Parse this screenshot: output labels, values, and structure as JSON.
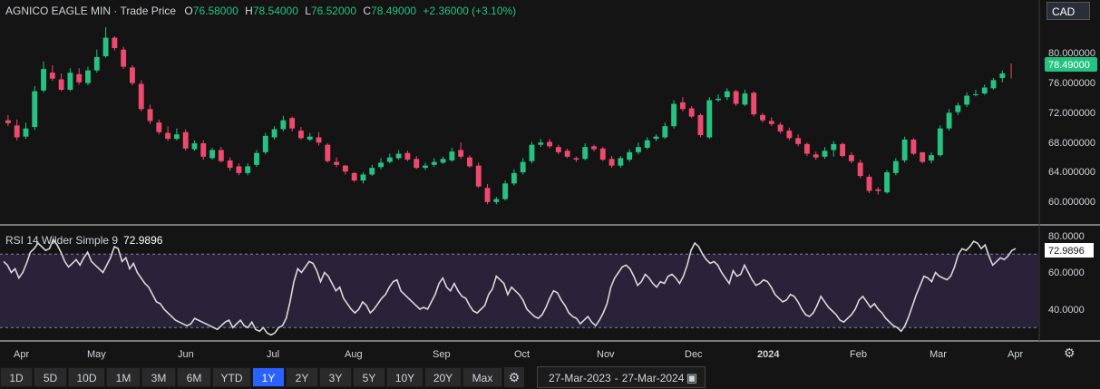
{
  "header": {
    "symbol": "AGNICO EAGLE MIN",
    "field": "Trade Price",
    "o_label": "O",
    "o": "76.58000",
    "h_label": "H",
    "h": "78.54000",
    "l_label": "L",
    "l": "76.52000",
    "c_label": "C",
    "c": "78.49000",
    "change": "+2.36000 (+3.10%)"
  },
  "currency": "CAD",
  "rsi_header": {
    "label": "RSI 14 Wilder Simple 9",
    "value": "72.9896"
  },
  "price_axis": {
    "ticks": [
      "80.000000",
      "76.000000",
      "72.000000",
      "68.000000",
      "64.000000",
      "60.000000"
    ],
    "last_price": "78.49000",
    "last_price_color": "#26c281"
  },
  "rsi_axis": {
    "ticks": [
      "80.0000",
      "60.0000",
      "40.0000"
    ],
    "last_value": "72.9896"
  },
  "x_axis": [
    "Apr",
    "May",
    "Jun",
    "Jul",
    "Aug",
    "Sep",
    "Oct",
    "Nov",
    "Dec",
    "2024",
    "Feb",
    "Mar",
    "Apr"
  ],
  "range_buttons": [
    "1D",
    "5D",
    "10D",
    "1M",
    "3M",
    "6M",
    "YTD",
    "1Y",
    "2Y",
    "3Y",
    "5Y",
    "10Y",
    "20Y",
    "Max"
  ],
  "range_active": "1Y",
  "date_range": {
    "from": "27-Mar-2023",
    "sep": "-",
    "to": "27-Mar-2024"
  },
  "icons": {
    "settings": "gear-icon",
    "calendar": "calendar-icon",
    "axis_settings": "gear-icon"
  },
  "colors": {
    "up": "#26c281",
    "down": "#ef4a6d",
    "rsi_line": "#d9d9d9",
    "rsi_band": "#2a2238"
  },
  "chart_data": [
    {
      "type": "candlestick",
      "title": "AGNICO EAGLE MIN - Trade Price",
      "ylim": [
        58,
        84
      ],
      "x": [
        "Apr",
        "May",
        "Jun",
        "Jul",
        "Aug",
        "Sep",
        "Oct",
        "Nov",
        "Dec",
        "2024",
        "Feb",
        "Mar",
        "Apr"
      ],
      "close": [
        70.5,
        68.6,
        69.8,
        74.8,
        77.8,
        76.5,
        75.0,
        77.3,
        76.0,
        77.6,
        79.4,
        82.0,
        80.6,
        78.1,
        75.9,
        72.4,
        70.8,
        69.3,
        68.4,
        69.0,
        67.1,
        67.8,
        66.0,
        66.9,
        65.4,
        64.5,
        63.8,
        64.7,
        66.5,
        68.8,
        69.7,
        70.9,
        69.8,
        68.5,
        68.7,
        67.9,
        65.4,
        64.9,
        64.0,
        62.8,
        63.6,
        64.5,
        65.2,
        65.9,
        66.4,
        65.6,
        64.5,
        64.8,
        65.3,
        65.7,
        66.7,
        66.0,
        64.7,
        62.0,
        59.9,
        60.3,
        62.4,
        63.8,
        65.3,
        67.6,
        67.9,
        67.4,
        66.6,
        66.0,
        65.6,
        67.3,
        67.0,
        65.6,
        64.8,
        65.8,
        66.6,
        67.3,
        68.2,
        68.7,
        70.1,
        73.1,
        72.4,
        71.4,
        68.9,
        73.6,
        73.8,
        74.8,
        73.1,
        74.5,
        71.7,
        70.9,
        70.4,
        69.4,
        68.5,
        67.7,
        66.4,
        65.9,
        66.8,
        67.7,
        66.1,
        65.4,
        63.4,
        61.4,
        61.4,
        63.9,
        65.4,
        68.3,
        66.4,
        65.3,
        66.2,
        69.8,
        71.9,
        72.9,
        74.2,
        74.4,
        75.3,
        76.3,
        77.2,
        78.5
      ],
      "open": [
        70.9,
        70.2,
        68.7,
        70.0,
        74.9,
        77.3,
        76.4,
        75.0,
        77.1,
        75.9,
        77.6,
        79.5,
        82.0,
        80.4,
        78.0,
        75.8,
        72.4,
        70.6,
        69.2,
        68.4,
        69.3,
        67.0,
        67.8,
        65.8,
        66.9,
        65.5,
        64.7,
        63.8,
        64.9,
        66.6,
        68.6,
        69.7,
        71.2,
        69.5,
        68.3,
        68.6,
        67.6,
        65.3,
        64.8,
        63.8,
        62.8,
        63.6,
        64.6,
        65.3,
        65.8,
        66.5,
        65.7,
        64.5,
        64.9,
        65.2,
        65.5,
        66.9,
        65.9,
        64.8,
        61.8,
        59.9,
        60.3,
        62.4,
        63.9,
        65.4,
        67.6,
        68.0,
        67.3,
        66.8,
        65.8,
        65.7,
        67.4,
        67.1,
        65.7,
        64.8,
        65.6,
        66.6,
        67.2,
        68.4,
        68.6,
        70.1,
        73.3,
        72.5,
        71.6,
        68.6,
        73.6,
        74.0,
        74.8,
        73.0,
        74.6,
        71.6,
        70.8,
        70.3,
        69.5,
        68.5,
        67.7,
        66.3,
        66.0,
        66.9,
        67.7,
        66.2,
        65.2,
        63.3,
        61.6,
        61.2,
        63.8,
        65.5,
        68.3,
        66.6,
        65.5,
        66.2,
        69.8,
        72.0,
        73.0,
        74.4,
        74.5,
        75.2,
        76.58
      ],
      "high": [
        71.6,
        71.0,
        70.6,
        75.5,
        78.8,
        78.3,
        77.2,
        77.9,
        77.9,
        78.1,
        80.4,
        83.4,
        82.2,
        80.8,
        78.3,
        76.3,
        73.0,
        71.0,
        70.1,
        69.8,
        69.7,
        68.2,
        68.2,
        67.2,
        67.3,
        65.9,
        65.1,
        65.1,
        66.9,
        69.2,
        70.1,
        71.5,
        71.4,
        70.0,
        69.2,
        69.3,
        67.8,
        65.9,
        64.9,
        63.9,
        63.9,
        64.9,
        65.8,
        66.4,
        66.9,
        66.8,
        66.1,
        65.2,
        65.8,
        66.0,
        67.2,
        67.9,
        66.2,
        65.2,
        62.3,
        60.6,
        62.8,
        64.3,
        65.8,
        68.0,
        68.4,
        68.4,
        67.6,
        67.1,
        66.0,
        67.8,
        67.6,
        67.3,
        66.1,
        66.1,
        67.0,
        67.9,
        68.6,
        69.0,
        70.6,
        73.6,
        74.0,
        72.8,
        71.8,
        74.0,
        74.4,
        75.2,
        75.0,
        75.0,
        74.8,
        71.9,
        71.3,
        70.6,
        69.9,
        69.0,
        67.9,
        66.7,
        67.3,
        68.1,
        67.9,
        66.6,
        65.6,
        63.6,
        61.9,
        64.2,
        65.8,
        68.7,
        68.5,
        66.5,
        66.6,
        70.2,
        72.4,
        73.3,
        74.6,
        75.0,
        75.7,
        76.6,
        77.6,
        78.54
      ],
      "low": [
        70.1,
        68.2,
        68.4,
        69.6,
        74.6,
        76.2,
        74.8,
        74.8,
        75.7,
        75.6,
        77.3,
        79.3,
        80.3,
        77.8,
        75.6,
        72.1,
        70.4,
        69.0,
        68.1,
        68.2,
        66.8,
        66.8,
        65.6,
        65.6,
        65.2,
        64.1,
        63.5,
        63.5,
        64.6,
        66.3,
        68.3,
        69.4,
        69.4,
        68.3,
        68.1,
        67.5,
        65.2,
        64.6,
        63.6,
        62.6,
        62.4,
        63.4,
        64.3,
        65.1,
        65.6,
        65.4,
        64.3,
        64.2,
        64.6,
        65.0,
        65.3,
        65.7,
        64.5,
        61.8,
        59.6,
        59.6,
        60.1,
        62.1,
        63.6,
        65.1,
        67.3,
        67.1,
        66.3,
        65.8,
        65.3,
        65.5,
        66.7,
        65.4,
        64.5,
        64.5,
        65.3,
        66.3,
        67.0,
        68.1,
        68.4,
        69.8,
        72.1,
        71.2,
        68.6,
        68.4,
        73.4,
        73.6,
        72.8,
        72.8,
        71.4,
        70.6,
        70.1,
        69.1,
        68.2,
        67.4,
        66.1,
        65.6,
        65.7,
        66.0,
        65.9,
        65.1,
        63.1,
        61.1,
        60.9,
        61.0,
        63.5,
        65.2,
        66.2,
        65.1,
        65.1,
        66.0,
        69.5,
        71.6,
        72.7,
        74.1,
        74.3,
        75.0,
        76.0,
        76.52
      ]
    },
    {
      "type": "line",
      "title": "RSI 14 Wilder Simple 9",
      "ylim": [
        27,
        85
      ],
      "reference_lines": [
        70,
        30
      ],
      "x": [
        "Apr",
        "May",
        "Jun",
        "Jul",
        "Aug",
        "Sep",
        "Oct",
        "Nov",
        "Dec",
        "2024",
        "Feb",
        "Mar",
        "Apr"
      ],
      "values": [
        66,
        64,
        60,
        62,
        57,
        60,
        65,
        71,
        73,
        76,
        74,
        72,
        73,
        78,
        75,
        71,
        66,
        63,
        65,
        67,
        64,
        68,
        71,
        66,
        64,
        62,
        60,
        64,
        68,
        74,
        73,
        66,
        68,
        62,
        65,
        60,
        57,
        54,
        52,
        48,
        44,
        43,
        40,
        38,
        36,
        34,
        33,
        32,
        31,
        32,
        35,
        34,
        33,
        32,
        31,
        30,
        29,
        31,
        33,
        34,
        30,
        32,
        34,
        31,
        30,
        33,
        29,
        28,
        30,
        27,
        26,
        27,
        30,
        31,
        35,
        44,
        55,
        62,
        60,
        63,
        66,
        65,
        61,
        55,
        60,
        58,
        54,
        50,
        52,
        46,
        43,
        40,
        38,
        40,
        44,
        42,
        38,
        40,
        43,
        46,
        48,
        52,
        55,
        56,
        50,
        48,
        46,
        44,
        42,
        40,
        41,
        40,
        44,
        48,
        54,
        57,
        52,
        50,
        54,
        50,
        47,
        46,
        42,
        39,
        38,
        40,
        42,
        48,
        51,
        58,
        56,
        54,
        48,
        52,
        50,
        48,
        45,
        40,
        38,
        36,
        35,
        37,
        41,
        46,
        50,
        49,
        45,
        42,
        38,
        36,
        35,
        32,
        34,
        36,
        33,
        31,
        34,
        38,
        43,
        52,
        57,
        60,
        63,
        64,
        62,
        58,
        53,
        55,
        59,
        57,
        54,
        52,
        55,
        54,
        58,
        59,
        57,
        54,
        58,
        64,
        72,
        76,
        74,
        70,
        67,
        65,
        66,
        64,
        60,
        57,
        54,
        61,
        58,
        59,
        64,
        60,
        56,
        53,
        54,
        56,
        55,
        52,
        48,
        46,
        44,
        45,
        48,
        47,
        44,
        40,
        37,
        36,
        38,
        42,
        47,
        44,
        41,
        39,
        37,
        34,
        33,
        35,
        37,
        40,
        45,
        47,
        44,
        41,
        43,
        40,
        38,
        35,
        33,
        31,
        30,
        28,
        31,
        36,
        42,
        48,
        53,
        58,
        57,
        55,
        60,
        58,
        57,
        56,
        58,
        63,
        70,
        73,
        72,
        74,
        77,
        76,
        73,
        75,
        69,
        64,
        66,
        68,
        67,
        69,
        72,
        73
      ]
    }
  ]
}
